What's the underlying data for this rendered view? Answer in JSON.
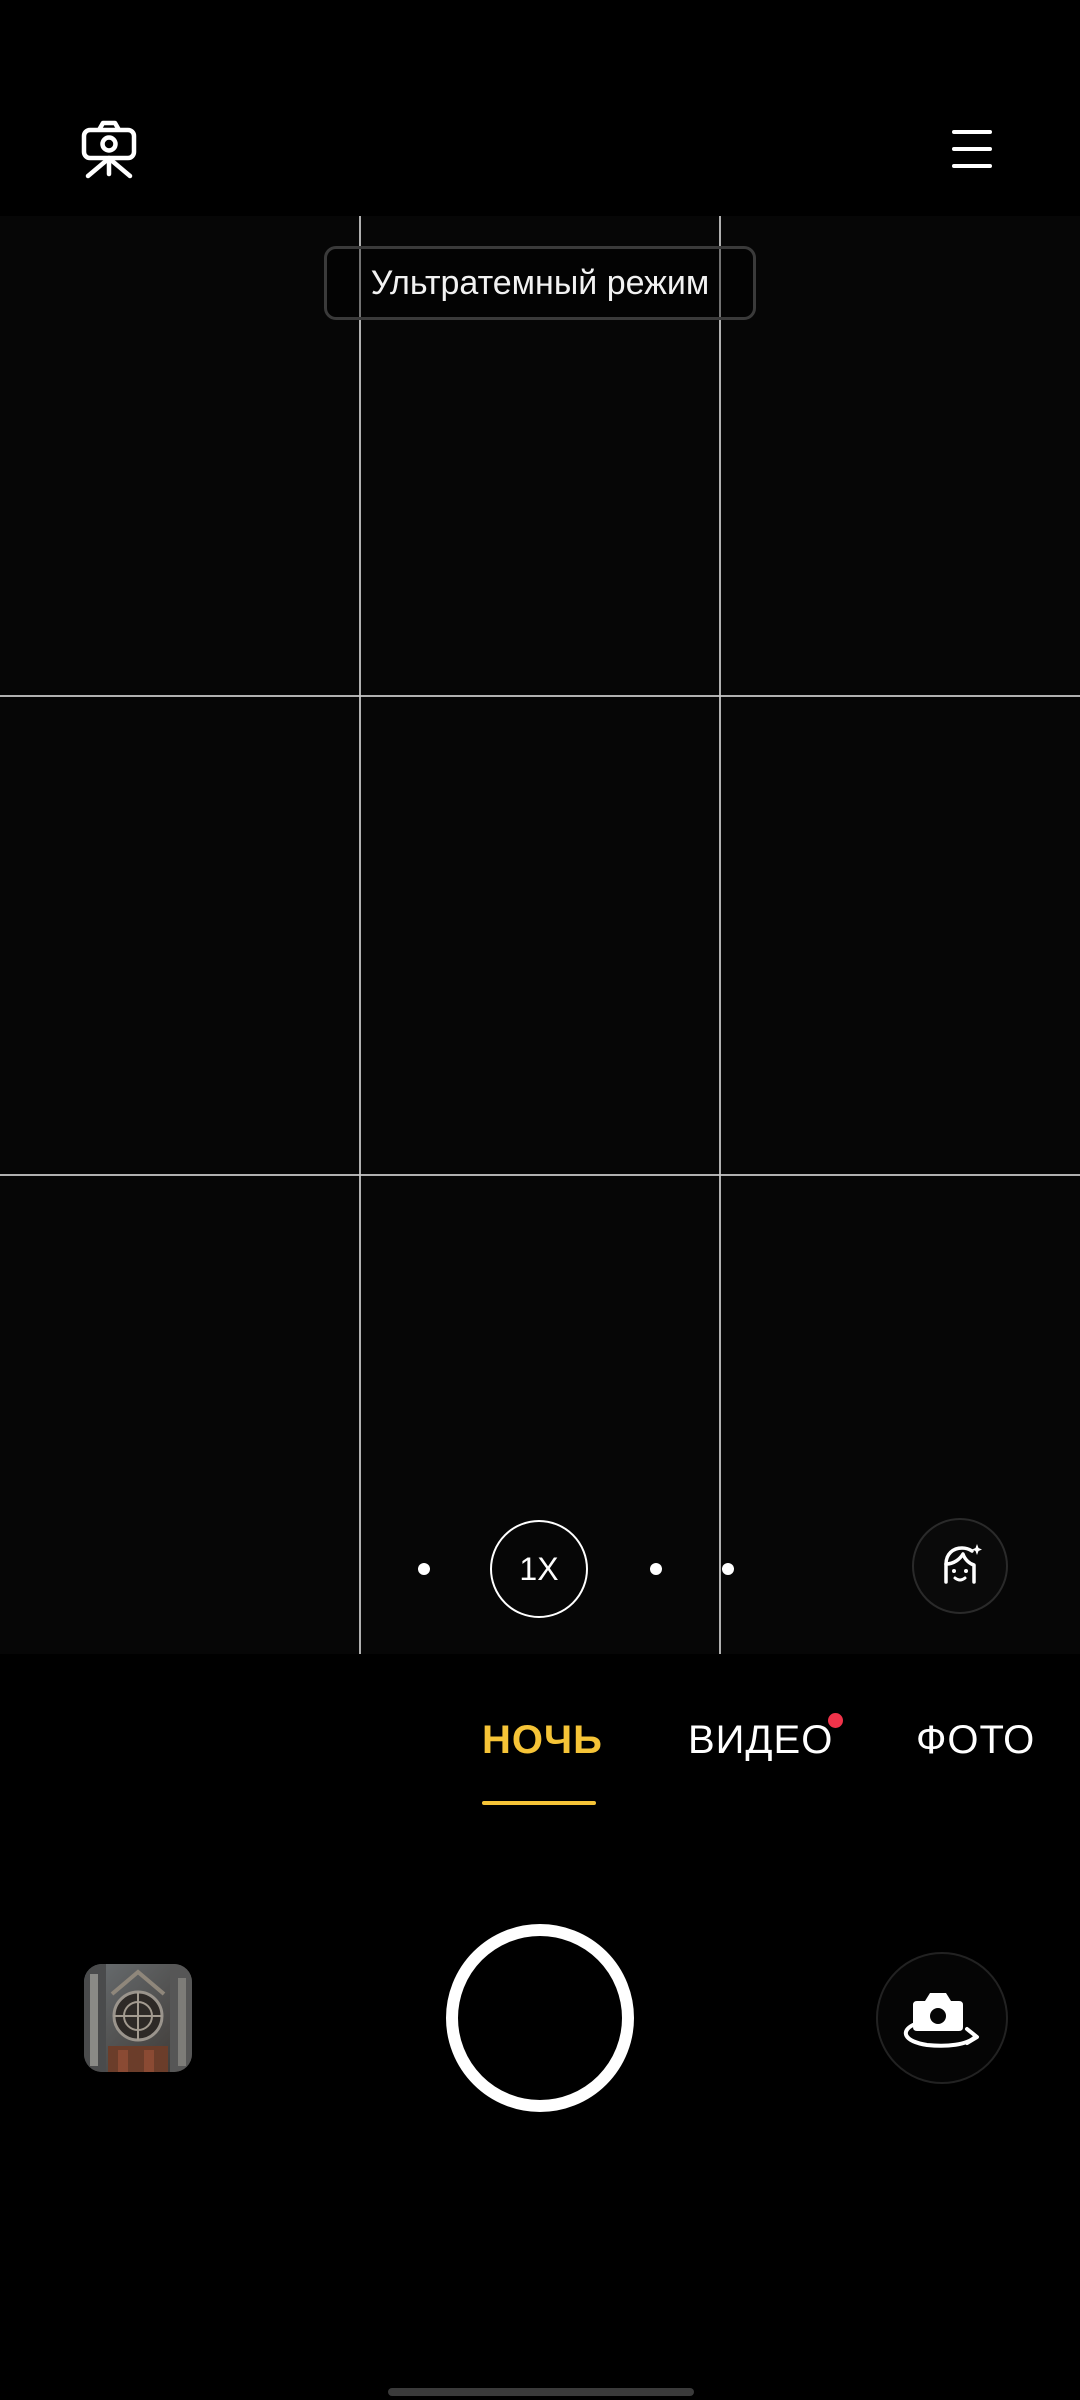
{
  "top_bar": {
    "tripod_icon": "tripod-camera-icon",
    "menu_icon": "hamburger-menu-icon"
  },
  "viewfinder": {
    "mode_tip": "Ультратемный режим",
    "zoom_label": "1X",
    "beauty_icon": "face-beauty-icon"
  },
  "modes": {
    "items": [
      "НОЧЬ",
      "ВИДЕО",
      "ФОТО"
    ],
    "selected": "НОЧЬ",
    "accent_color": "#f6c437",
    "notification_dot_color": "#f0334a"
  },
  "controls": {
    "gallery_icon": "gallery-thumbnail",
    "shutter_icon": "shutter-button",
    "flip_icon": "flip-camera-icon"
  }
}
